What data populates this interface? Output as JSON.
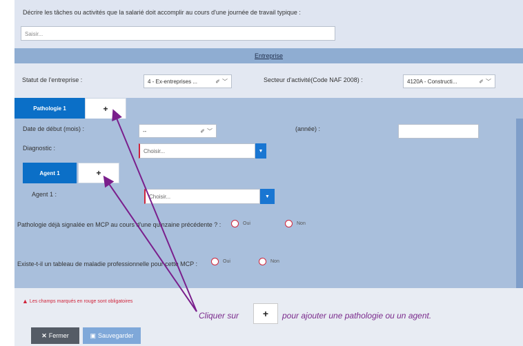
{
  "tasks": {
    "label": "Décrire les tâches ou activités que la salarié doit accomplir au cours d'une journée de travail typique :",
    "placeholder": "Saisir..."
  },
  "entreprise": {
    "section_title": "Entreprise",
    "statut_label": "Statut de l'entreprise :",
    "statut_value": "4 - Ex-entreprises ...",
    "secteur_label": "Secteur d'activité(Code NAF 2008) :",
    "secteur_value": "4120A - Constructi..."
  },
  "pathologie": {
    "tab_label": "Pathologie 1",
    "add_symbol": "+",
    "date_debut_label": "Date de début (mois) :",
    "date_debut_value": "--",
    "annee_label": "(année) :",
    "annee_value": "",
    "diagnostic_label": "Diagnostic :",
    "diagnostic_placeholder": "Choisir...",
    "agent_tab_label": "Agent 1",
    "agent_add_symbol": "+",
    "agent_label": "Agent 1 :",
    "agent_placeholder": "Choisir...",
    "q1_label": "Pathologie déjà signalée en MCP au cours d'une quinzaine précédente ? :",
    "q2_label": "Existe-t-il un tableau de maladie professionnelle pour cette MCP :",
    "oui": "Oui",
    "non": "Non"
  },
  "footer": {
    "required_note": "Les champs marqués en rouge sont obligatoires",
    "close_label": "Fermer",
    "save_label": "Sauvegarder"
  },
  "annotation": {
    "prefix": "Cliquer sur",
    "plus": "+",
    "suffix": "pour ajouter une pathologie ou un agent."
  },
  "colors": {
    "accent_blue": "#0b6fc7",
    "required_red": "#d0243a",
    "annotation_purple": "#7a1f8c"
  },
  "icons": {
    "eraser": "eraser-icon",
    "chevron": "chevron-down-icon",
    "caret": "caret-down-icon",
    "warning": "warning-icon",
    "close": "close-icon",
    "save": "floppy-icon"
  }
}
